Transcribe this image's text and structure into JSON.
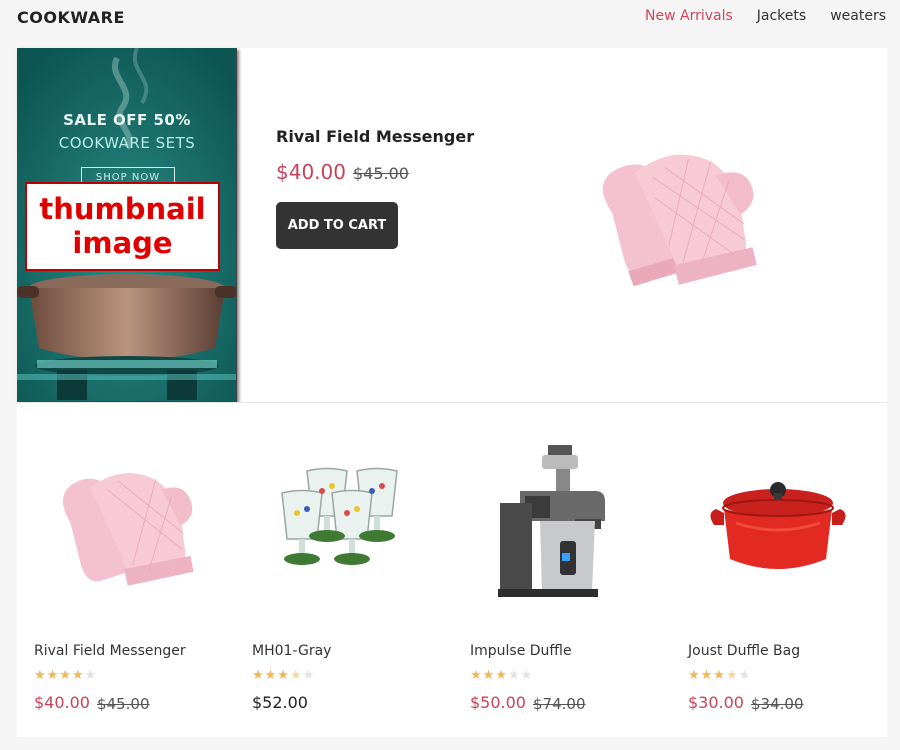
{
  "header": {
    "brand": "COOKWARE",
    "nav": [
      {
        "label": "New Arrivals",
        "active": true
      },
      {
        "label": "Jackets",
        "active": false
      },
      {
        "label": "weaters",
        "active": false
      }
    ]
  },
  "banner": {
    "headline": "SALE OFF 50%",
    "subline": "COOKWARE SETS",
    "cta": "SHOP NOW",
    "overlay_label": "thumbnail image"
  },
  "hero": {
    "title": "Rival Field Messenger",
    "price": "$40.00",
    "old_price": "$45.00",
    "add_to_cart": "ADD TO CART",
    "image_icon": "oven-mitt-icon"
  },
  "products": [
    {
      "name": "Rival Field Messenger",
      "rating": 4,
      "price": "$40.00",
      "old_price": "$45.00",
      "icon": "oven-mitt-icon"
    },
    {
      "name": "MH01-Gray",
      "rating": 3.5,
      "price": "$52.00",
      "old_price": "",
      "icon": "glassware-icon"
    },
    {
      "name": "Impulse Duffle",
      "rating": 3,
      "price": "$50.00",
      "old_price": "$74.00",
      "icon": "juicer-icon"
    },
    {
      "name": "Joust Duffle Bag",
      "rating": 3.5,
      "price": "$30.00",
      "old_price": "$34.00",
      "icon": "dutch-oven-icon"
    }
  ],
  "colors": {
    "accent": "#c8435a",
    "star": "#f0b75a",
    "banner_bg": "#126b68",
    "button_bg": "#333333"
  }
}
